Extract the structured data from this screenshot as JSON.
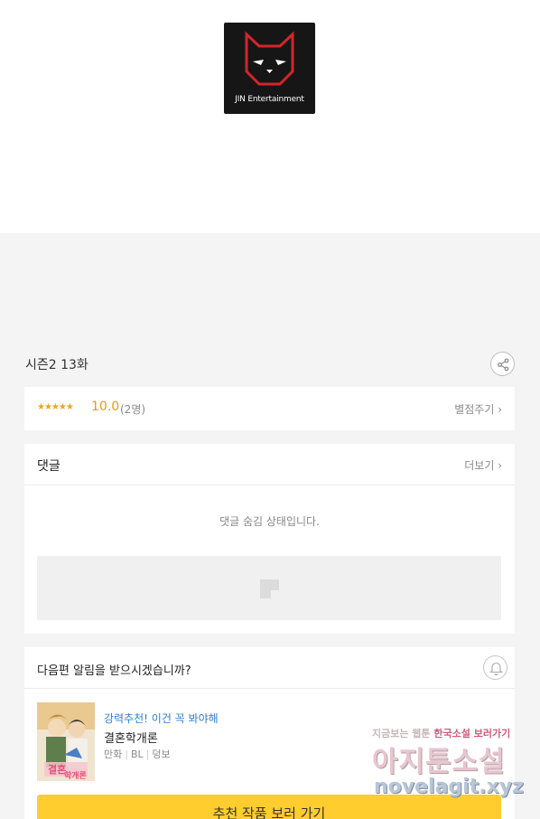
{
  "logo": {
    "text": "JIN Entertainment",
    "icon": "cat-head-icon"
  },
  "episode": {
    "title": "시즌2 13화",
    "share_icon": "share-icon"
  },
  "rating": {
    "stars": "★★★★★",
    "score": "10.0",
    "count": "(2명)",
    "rate_link": "별점주기 ›"
  },
  "comments": {
    "title": "댓글",
    "more": "더보기 ›",
    "hidden_message": "댓글 숨김 상태입니다."
  },
  "notify": {
    "question": "다음편 알림을 받으시겠습니까?",
    "bell_icon": "bell-icon"
  },
  "recommend": {
    "tag": "강력추천! 이건 꼭 봐야해",
    "title": "결혼학개론",
    "genre": "만화",
    "category": "BL",
    "platform": "덩보",
    "cta": "추천 작품 보러 가기"
  },
  "watermark": {
    "top_left": "지금보는 웹툰",
    "top_accent": "한국소설 보러가기",
    "main": "아지툰소설",
    "url": "novelagit.xyz"
  },
  "colors": {
    "accent_yellow": "#ffcd2e",
    "rating_orange": "#e89a17",
    "link_blue": "#2e7fd0",
    "logo_red": "#d3252b"
  }
}
